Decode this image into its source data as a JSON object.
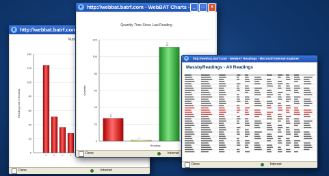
{
  "windows": {
    "left": {
      "title": "http://webbat.batrf.com",
      "chart_title": "Number of Tim",
      "status_left": "Done",
      "status_right": "Internet"
    },
    "middle": {
      "title": "http://webbat.batrf.com - WebBAT Charts -",
      "chart_title": "Quantity Time Since Last Reading",
      "status_left": "Done",
      "status_right": "Internet"
    },
    "right": {
      "title": "http://webbat.batrf.com - WebBAT Readings - Microsoft Internet Explorer",
      "table_title": "MassbyReadings - All Readings",
      "status_left": "Done",
      "status_right": "Internet"
    }
  },
  "chart_data": [
    {
      "type": "bar",
      "title": "Quantity Time Since Last Reading",
      "ylabel": "Quantity",
      "xlabel": "Reading",
      "ylim": [
        0,
        120
      ],
      "yticks": [
        0,
        20,
        40,
        60,
        80,
        100,
        120
      ],
      "categories": [
        "A",
        "B",
        "C",
        "D"
      ],
      "values": [
        27,
        1,
        111,
        1
      ],
      "colors": [
        "#cc2222",
        "#dddd33",
        "#22aa33",
        "#aaaaaa"
      ]
    },
    {
      "type": "bar",
      "title": "Number of Tim",
      "ylabel": "Readings out of bounds",
      "ylim": [
        0,
        140
      ],
      "yticks": [
        0,
        20,
        40,
        60,
        80,
        100,
        120,
        140
      ],
      "categories": [
        "1",
        "2",
        "3",
        "4",
        "5",
        "6",
        "7"
      ],
      "values": [
        124,
        51,
        36,
        28,
        20,
        6,
        2
      ],
      "colors": [
        "#cc2222"
      ]
    }
  ]
}
